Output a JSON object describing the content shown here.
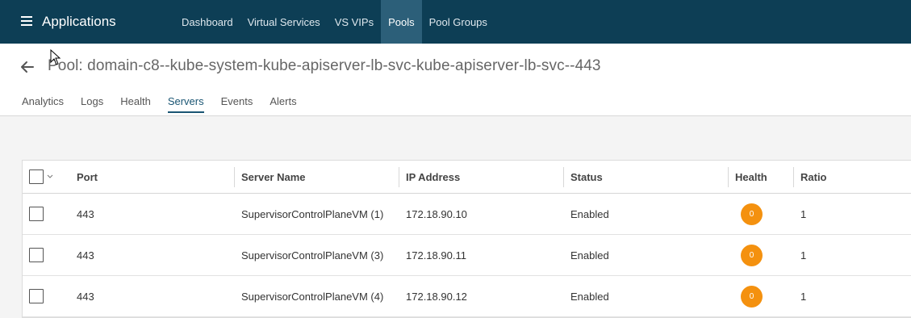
{
  "topbar": {
    "menu_icon": "hamburger-icon",
    "app_title": "Applications",
    "nav": [
      {
        "label": "Dashboard",
        "active": false
      },
      {
        "label": "Virtual Services",
        "active": false
      },
      {
        "label": "VS VIPs",
        "active": false
      },
      {
        "label": "Pools",
        "active": true
      },
      {
        "label": "Pool Groups",
        "active": false
      }
    ]
  },
  "header": {
    "back_icon": "back-arrow-icon",
    "title": "Pool: domain-c8--kube-system-kube-apiserver-lb-svc-kube-apiserver-lb-svc--443",
    "tabs": [
      {
        "label": "Analytics",
        "active": false
      },
      {
        "label": "Logs",
        "active": false
      },
      {
        "label": "Health",
        "active": false
      },
      {
        "label": "Servers",
        "active": true
      },
      {
        "label": "Events",
        "active": false
      },
      {
        "label": "Alerts",
        "active": false
      }
    ]
  },
  "table": {
    "columns": [
      "Port",
      "Server Name",
      "IP Address",
      "Status",
      "Health",
      "Ratio"
    ],
    "rows": [
      {
        "port": "443",
        "server_name": "SupervisorControlPlaneVM (1)",
        "ip": "172.18.90.10",
        "status": "Enabled",
        "health": "0",
        "ratio": "1"
      },
      {
        "port": "443",
        "server_name": "SupervisorControlPlaneVM (3)",
        "ip": "172.18.90.11",
        "status": "Enabled",
        "health": "0",
        "ratio": "1"
      },
      {
        "port": "443",
        "server_name": "SupervisorControlPlaneVM (4)",
        "ip": "172.18.90.12",
        "status": "Enabled",
        "health": "0",
        "ratio": "1"
      }
    ]
  },
  "colors": {
    "topbar_bg": "#0d3e55",
    "nav_active_bg": "#2c5f79",
    "tab_active": "#1a5573",
    "health_badge": "#f4910f"
  }
}
